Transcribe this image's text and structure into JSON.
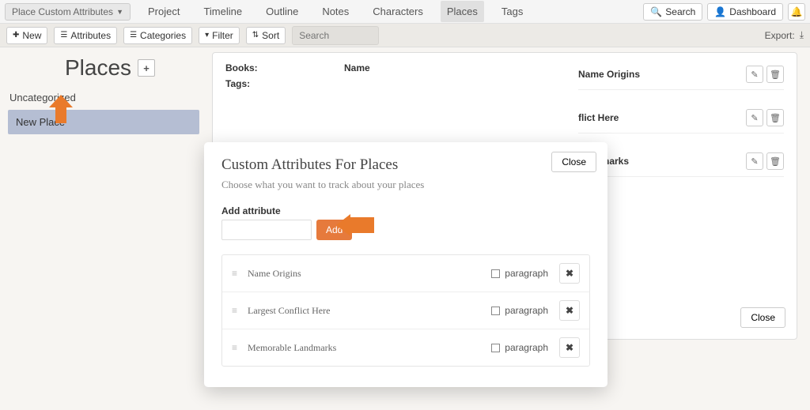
{
  "top": {
    "project_dd": "Place Custom Attributes",
    "nav": [
      "Project",
      "Timeline",
      "Outline",
      "Notes",
      "Characters",
      "Places",
      "Tags"
    ],
    "active_nav": "Places",
    "search_btn": "Search",
    "dashboard_btn": "Dashboard"
  },
  "toolbar": {
    "new_btn": "New",
    "attributes_btn": "Attributes",
    "categories_btn": "Categories",
    "filter_btn": "Filter",
    "sort_btn": "Sort",
    "search_placeholder": "Search",
    "export_label": "Export:"
  },
  "page": {
    "title": "Places",
    "category": "Uncategorized",
    "selected_place": "New Place"
  },
  "detail": {
    "books_label": "Books:",
    "tags_label": "Tags:",
    "name_label": "Name",
    "attrs": [
      "Name Origins",
      "flict Here",
      "Landmarks"
    ],
    "close": "Close"
  },
  "modal": {
    "title": "Custom Attributes For Places",
    "subtitle": "Choose what you want to track about your places",
    "add_label": "Add attribute",
    "add_btn": "Add",
    "close": "Close",
    "type_label": "paragraph",
    "rows": [
      "Name Origins",
      "Largest Conflict Here",
      "Memorable Landmarks"
    ]
  }
}
